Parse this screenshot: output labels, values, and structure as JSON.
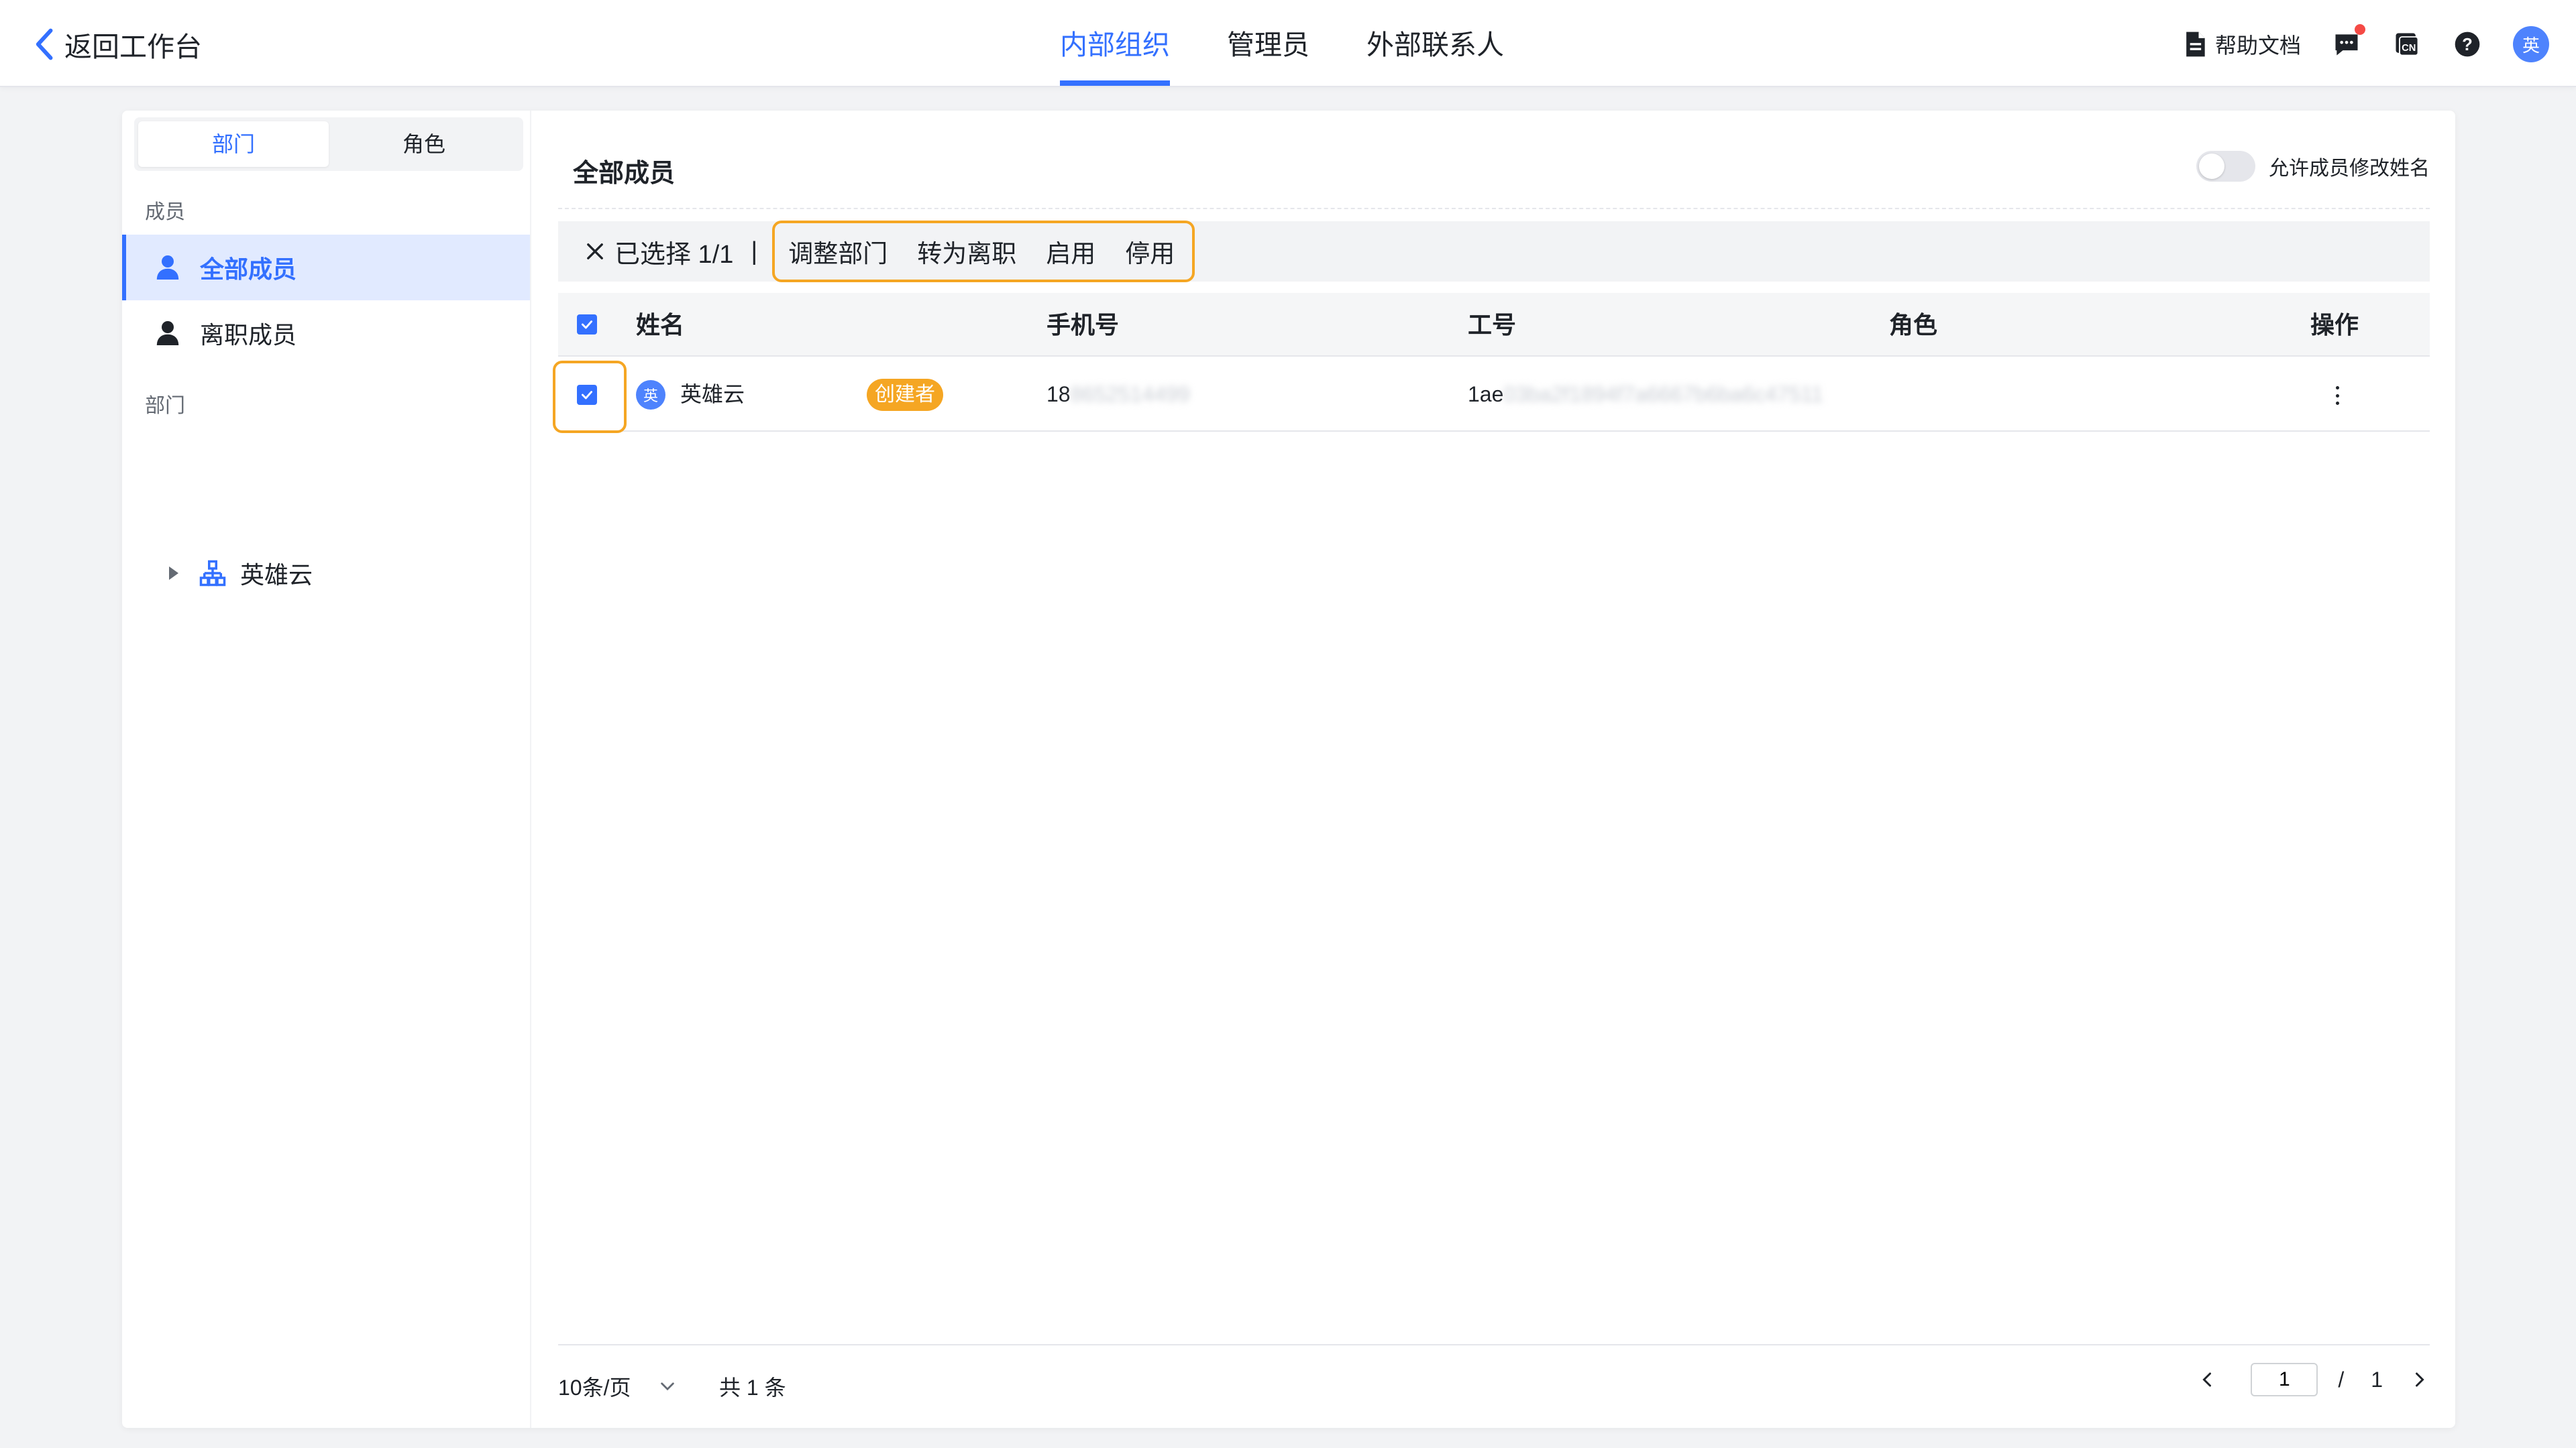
{
  "header": {
    "back_label": "返回工作台",
    "tabs": [
      {
        "label": "内部组织",
        "active": true
      },
      {
        "label": "管理员",
        "active": false
      },
      {
        "label": "外部联系人",
        "active": false
      }
    ],
    "help_label": "帮助文档",
    "lang_label": "CN",
    "avatar_text": "英"
  },
  "sidebar": {
    "segments": [
      {
        "label": "部门",
        "active": true
      },
      {
        "label": "角色",
        "active": false
      }
    ],
    "members_section": "成员",
    "member_items": [
      {
        "label": "全部成员",
        "active": true
      },
      {
        "label": "离职成员",
        "active": false
      }
    ],
    "dept_section": "部门",
    "dept_tree": [
      {
        "label": "英雄云"
      }
    ]
  },
  "main": {
    "title": "全部成员",
    "toggle_label": "允许成员修改姓名",
    "toggle_on": false,
    "batch": {
      "selected_text": "已选择 1/1",
      "separator": "|",
      "actions": [
        "调整部门",
        "转为离职",
        "启用",
        "停用"
      ]
    },
    "table": {
      "columns": [
        "姓名",
        "手机号",
        "工号",
        "角色",
        "操作"
      ],
      "rows": [
        {
          "avatar": "英",
          "name": "英雄云",
          "badge": "创建者",
          "phone_visible": "18",
          "phone_blurred": "8652514499",
          "job_no_visible": "1ae",
          "job_no_blurred": "03ba2f1894f7a6667b6ba6c47511",
          "role": "",
          "checked": true
        }
      ]
    },
    "pagination": {
      "page_size": "10条/页",
      "total": "共 1 条",
      "current_page": "1",
      "separator": "/",
      "total_pages": "1"
    }
  },
  "colors": {
    "accent": "#3370ff",
    "highlight": "#f5a623",
    "badge": "#f5a623",
    "notification": "#f54a45"
  }
}
